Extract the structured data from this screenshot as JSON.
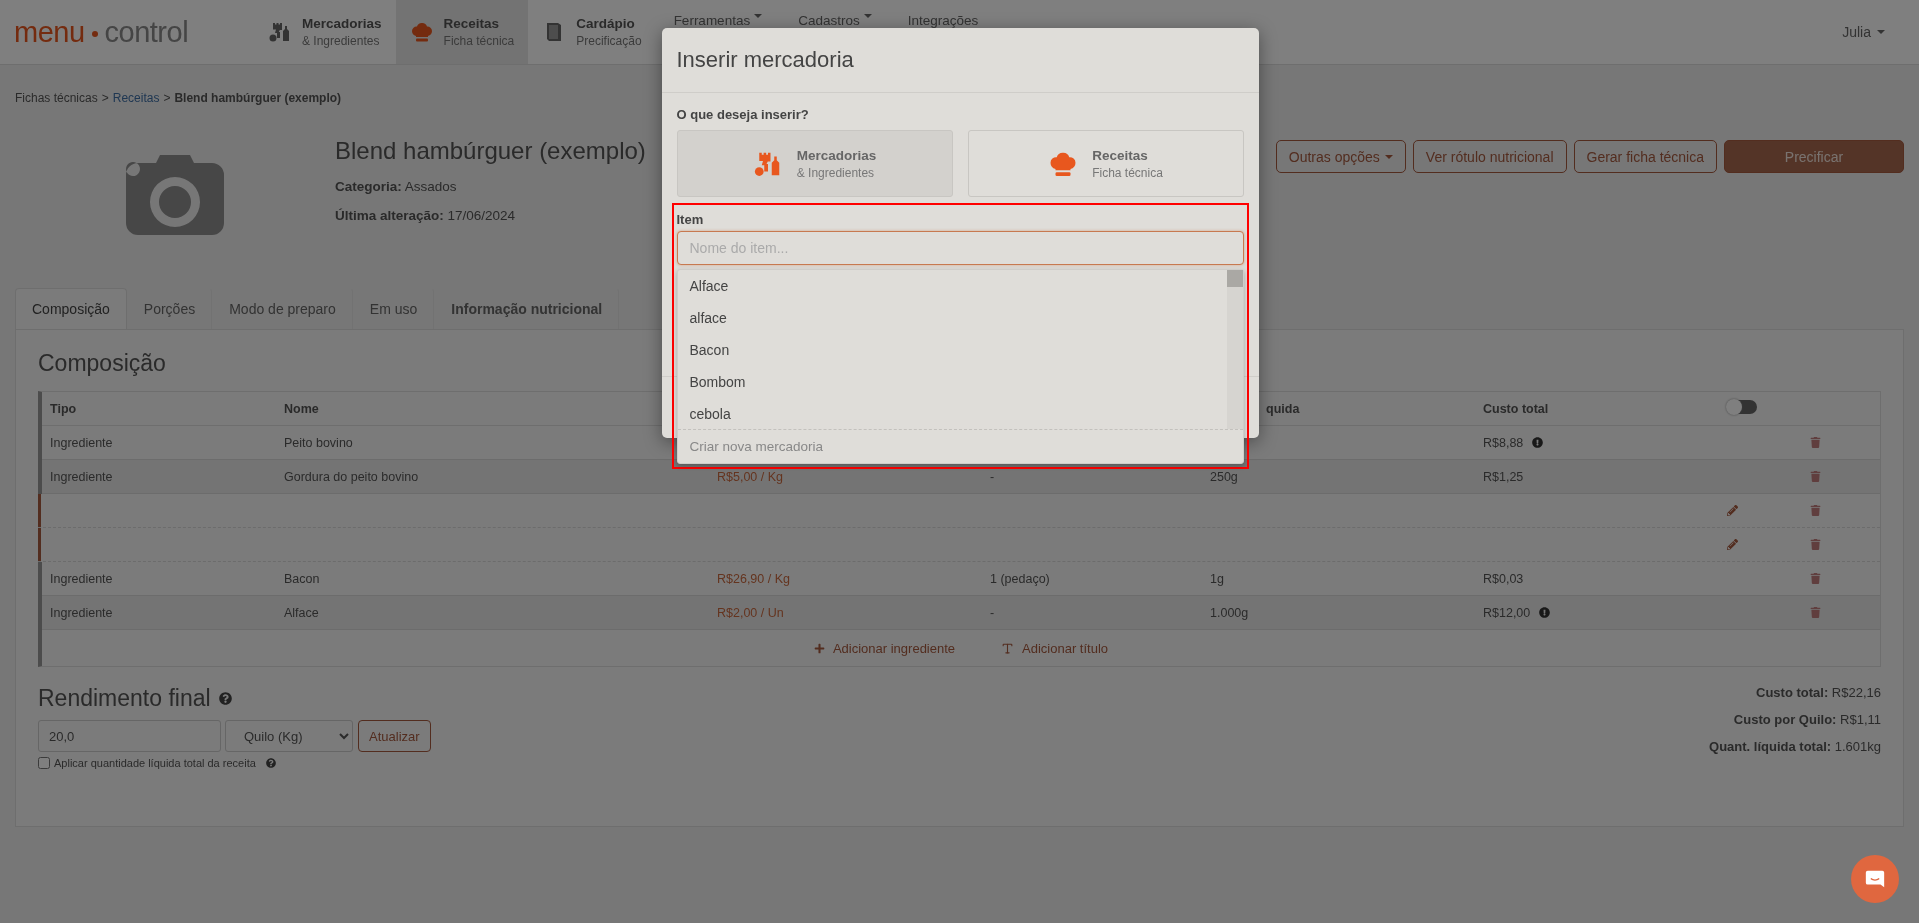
{
  "header": {
    "logo": {
      "word1": "menu",
      "word2": "control"
    },
    "nav": [
      {
        "kind": "module",
        "title": "Mercadorias",
        "subtitle": "& Ingredientes",
        "selected": false
      },
      {
        "kind": "module",
        "title": "Receitas",
        "subtitle": "Ficha técnica",
        "selected": true
      },
      {
        "kind": "module",
        "title": "Cardápio",
        "subtitle": "Precificação",
        "selected": false
      },
      {
        "kind": "menu",
        "title": "Ferramentas",
        "selected": false
      },
      {
        "kind": "menu",
        "title": "Cadastros",
        "selected": false
      },
      {
        "kind": "link",
        "title": "Integrações",
        "selected": false
      }
    ],
    "user": "Julia"
  },
  "breadcrumb": {
    "separator": ">",
    "items": [
      {
        "kind": "text",
        "label": "Fichas técnicas"
      },
      {
        "kind": "link",
        "label": "Receitas"
      },
      {
        "kind": "current",
        "label": "Blend hambúrguer (exemplo)"
      }
    ]
  },
  "recipe": {
    "title": "Blend hambúrguer (exemplo)",
    "fields": [
      {
        "label": "Categoria:",
        "value": "Assados"
      },
      {
        "label": "Última alteração:",
        "value": "17/06/2024"
      }
    ]
  },
  "actions": [
    {
      "kind": "dropdown",
      "label": "Outras opções"
    },
    {
      "kind": "outline",
      "label": "Ver rótulo nutricional"
    },
    {
      "kind": "outline",
      "label": "Gerar ficha técnica"
    },
    {
      "kind": "primary",
      "label": "Precificar"
    }
  ],
  "tabs": [
    {
      "label": "Composição",
      "selected": true,
      "bold": false
    },
    {
      "label": "Porções",
      "selected": false,
      "bold": false
    },
    {
      "label": "Modo de preparo",
      "selected": false,
      "bold": false
    },
    {
      "label": "Em uso",
      "selected": false,
      "bold": false
    },
    {
      "label": "Informação nutricional",
      "selected": false,
      "bold": true
    }
  ],
  "composition": {
    "heading": "Composição",
    "columns": {
      "column_1": "Tipo",
      "column_2": "Nome",
      "column_5": "quida",
      "column_6": "Custo total"
    },
    "toggle": {
      "on": false
    },
    "rows": [
      {
        "kind": "ingredient",
        "cells": {
          "column_1": "Ingrediente",
          "column_2": "Peito bovino",
          "column_6": "R$8,88"
        },
        "warning": true
      },
      {
        "kind": "ingredient",
        "cells": {
          "column_1": "Ingrediente",
          "column_2": "Gordura do peito bovino",
          "column_3": "R$5,00 / Kg",
          "column_4": "-",
          "column_5": "250g",
          "column_6": "R$1,25"
        },
        "warning": false
      },
      {
        "kind": "title"
      },
      {
        "kind": "title"
      },
      {
        "kind": "ingredient",
        "cells": {
          "column_1": "Ingrediente",
          "column_2": "Bacon",
          "column_3": "R$26,90 / Kg",
          "column_4": "1 (pedaço)",
          "column_5": "1g",
          "column_6": "R$0,03"
        },
        "warning": false
      },
      {
        "kind": "ingredient",
        "cells": {
          "column_1": "Ingrediente",
          "column_2": "Alface",
          "column_3": "R$2,00 / Un",
          "column_4": "-",
          "column_5": "1.000g",
          "column_6": "R$12,00"
        },
        "warning": true
      }
    ],
    "links": [
      {
        "label": "Adicionar ingrediente"
      },
      {
        "label": "Adicionar título"
      }
    ]
  },
  "yield": {
    "heading": "Rendimento final",
    "amount": "20,0",
    "unit": "Quilo (Kg)",
    "button": "Atualizar",
    "checkbox": {
      "label": "Aplicar quantidade líquida total da receita",
      "checked": false
    }
  },
  "totals": [
    {
      "label": "Custo total:",
      "value": "R$22,16"
    },
    {
      "label": "Custo por Quilo:",
      "value": "R$1,11"
    },
    {
      "label": "Quant. líquida total:",
      "value": "1.601kg"
    }
  ],
  "modal": {
    "title": "Inserir mercadoria",
    "question": "O que deseja inserir?",
    "highlight": true,
    "choices": [
      {
        "title": "Mercadorias",
        "subtitle": "& Ingredientes",
        "selected": true
      },
      {
        "title": "Receitas",
        "subtitle": "Ficha técnica",
        "selected": false
      }
    ],
    "field": {
      "label": "Item",
      "placeholder": "Nome do item..."
    },
    "options": [
      "Alface",
      "alface",
      "Bacon",
      "Bombom",
      "cebola"
    ],
    "create": "Criar nova mercadoria"
  }
}
